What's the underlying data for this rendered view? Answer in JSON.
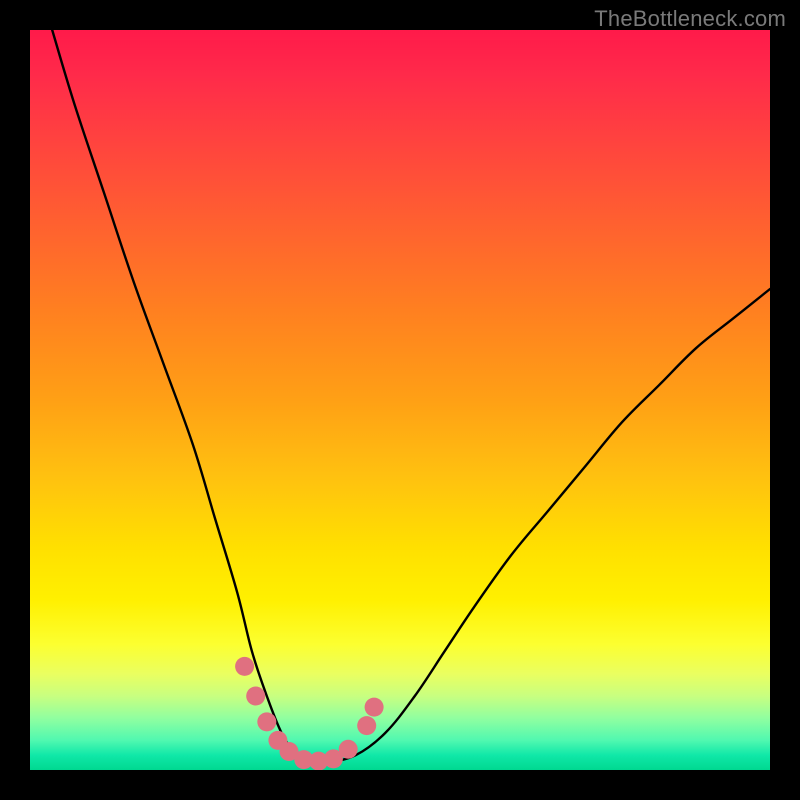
{
  "watermark": "TheBottleneck.com",
  "chart_data": {
    "type": "line",
    "title": "",
    "xlabel": "",
    "ylabel": "",
    "xlim": [
      0,
      100
    ],
    "ylim": [
      0,
      100
    ],
    "grid": false,
    "series": [
      {
        "name": "bottleneck-curve",
        "x": [
          3,
          6,
          10,
          14,
          18,
          22,
          25,
          28,
          30,
          32,
          34,
          36,
          38,
          40,
          44,
          48,
          52,
          56,
          60,
          65,
          70,
          75,
          80,
          85,
          90,
          95,
          100
        ],
        "y": [
          100,
          90,
          78,
          66,
          55,
          44,
          34,
          24,
          16,
          10,
          5,
          2,
          1,
          1,
          2,
          5,
          10,
          16,
          22,
          29,
          35,
          41,
          47,
          52,
          57,
          61,
          65
        ]
      }
    ],
    "highlight_points": {
      "name": "highlight-dots",
      "color": "#e07080",
      "x": [
        29,
        30.5,
        32,
        33.5,
        35,
        37,
        39,
        41,
        43,
        45.5,
        46.5
      ],
      "y": [
        14,
        10,
        6.5,
        4,
        2.5,
        1.4,
        1.2,
        1.5,
        2.8,
        6,
        8.5
      ]
    }
  }
}
